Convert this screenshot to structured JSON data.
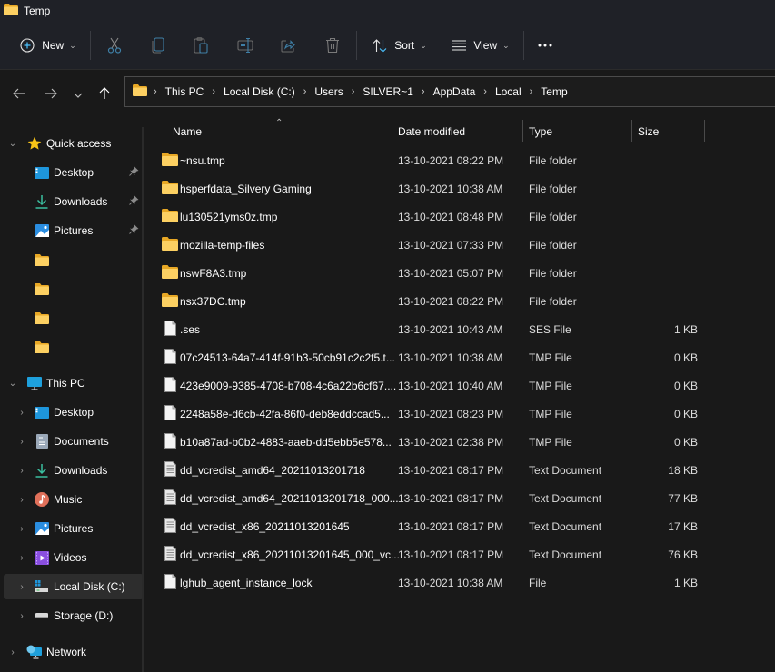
{
  "window": {
    "title": "Temp",
    "icon": "folder-icon"
  },
  "toolbar": {
    "new_label": "New",
    "sort_label": "Sort",
    "view_label": "View",
    "buttons": [
      {
        "name": "cut",
        "icon": "scissors-icon"
      },
      {
        "name": "copy",
        "icon": "copy-icon"
      },
      {
        "name": "paste",
        "icon": "paste-icon"
      },
      {
        "name": "rename",
        "icon": "rename-icon"
      },
      {
        "name": "share",
        "icon": "share-icon"
      },
      {
        "name": "delete",
        "icon": "trash-icon"
      }
    ],
    "more_icon": "ellipsis-icon"
  },
  "navigation": {
    "back_icon": "arrow-left-icon",
    "forward_icon": "arrow-right-icon",
    "recent_icon": "chevron-down-icon",
    "up_icon": "arrow-up-icon"
  },
  "breadcrumb": [
    "This PC",
    "Local Disk (C:)",
    "Users",
    "SILVER~1",
    "AppData",
    "Local",
    "Temp"
  ],
  "sidebar": {
    "quick_access": {
      "label": "Quick access",
      "items": [
        {
          "label": "Desktop",
          "icon": "desktop-icon",
          "pinned": true
        },
        {
          "label": "Downloads",
          "icon": "download-icon",
          "pinned": true
        },
        {
          "label": "Pictures",
          "icon": "pictures-icon",
          "pinned": true
        },
        {
          "label": "",
          "icon": "folder-icon",
          "pinned": false
        },
        {
          "label": "",
          "icon": "folder-icon",
          "pinned": false
        },
        {
          "label": "",
          "icon": "folder-icon",
          "pinned": false
        },
        {
          "label": "",
          "icon": "folder-icon",
          "pinned": false
        }
      ]
    },
    "this_pc": {
      "label": "This PC",
      "items": [
        {
          "label": "Desktop",
          "icon": "desktop-icon"
        },
        {
          "label": "Documents",
          "icon": "documents-icon"
        },
        {
          "label": "Downloads",
          "icon": "download-icon"
        },
        {
          "label": "Music",
          "icon": "music-icon"
        },
        {
          "label": "Pictures",
          "icon": "pictures-icon"
        },
        {
          "label": "Videos",
          "icon": "videos-icon"
        },
        {
          "label": "Local Disk (C:)",
          "icon": "system-drive-icon",
          "selected": true
        },
        {
          "label": "Storage (D:)",
          "icon": "drive-icon"
        }
      ]
    },
    "network": {
      "label": "Network",
      "icon": "network-icon"
    }
  },
  "columns": {
    "name": "Name",
    "date": "Date modified",
    "type": "Type",
    "size": "Size"
  },
  "files": [
    {
      "name": "~nsu.tmp",
      "date": "13-10-2021 08:22 PM",
      "type": "File folder",
      "size": "",
      "kind": "folder"
    },
    {
      "name": "hsperfdata_Silvery Gaming",
      "date": "13-10-2021 10:38 AM",
      "type": "File folder",
      "size": "",
      "kind": "folder"
    },
    {
      "name": "lu130521yms0z.tmp",
      "date": "13-10-2021 08:48 PM",
      "type": "File folder",
      "size": "",
      "kind": "folder"
    },
    {
      "name": "mozilla-temp-files",
      "date": "13-10-2021 07:33 PM",
      "type": "File folder",
      "size": "",
      "kind": "folder"
    },
    {
      "name": "nswF8A3.tmp",
      "date": "13-10-2021 05:07 PM",
      "type": "File folder",
      "size": "",
      "kind": "folder"
    },
    {
      "name": "nsx37DC.tmp",
      "date": "13-10-2021 08:22 PM",
      "type": "File folder",
      "size": "",
      "kind": "folder"
    },
    {
      "name": ".ses",
      "date": "13-10-2021 10:43 AM",
      "type": "SES File",
      "size": "1 KB",
      "kind": "file"
    },
    {
      "name": "07c24513-64a7-414f-91b3-50cb91c2c2f5.t...",
      "date": "13-10-2021 10:38 AM",
      "type": "TMP File",
      "size": "0 KB",
      "kind": "file"
    },
    {
      "name": "423e9009-9385-4708-b708-4c6a22b6cf67....",
      "date": "13-10-2021 10:40 AM",
      "type": "TMP File",
      "size": "0 KB",
      "kind": "file"
    },
    {
      "name": "2248a58e-d6cb-42fa-86f0-deb8eddccad5...",
      "date": "13-10-2021 08:23 PM",
      "type": "TMP File",
      "size": "0 KB",
      "kind": "file"
    },
    {
      "name": "b10a87ad-b0b2-4883-aaeb-dd5ebb5e578...",
      "date": "13-10-2021 02:38 PM",
      "type": "TMP File",
      "size": "0 KB",
      "kind": "file"
    },
    {
      "name": "dd_vcredist_amd64_20211013201718",
      "date": "13-10-2021 08:17 PM",
      "type": "Text Document",
      "size": "18 KB",
      "kind": "text"
    },
    {
      "name": "dd_vcredist_amd64_20211013201718_000...",
      "date": "13-10-2021 08:17 PM",
      "type": "Text Document",
      "size": "77 KB",
      "kind": "text"
    },
    {
      "name": "dd_vcredist_x86_20211013201645",
      "date": "13-10-2021 08:17 PM",
      "type": "Text Document",
      "size": "17 KB",
      "kind": "text"
    },
    {
      "name": "dd_vcredist_x86_20211013201645_000_vc...",
      "date": "13-10-2021 08:17 PM",
      "type": "Text Document",
      "size": "76 KB",
      "kind": "text"
    },
    {
      "name": "lghub_agent_instance_lock",
      "date": "13-10-2021 10:38 AM",
      "type": "File",
      "size": "1 KB",
      "kind": "file"
    }
  ],
  "colors": {
    "accent": "#4cc2ff",
    "folder": "#f4c542",
    "selected_bg": "#2d2d2d"
  }
}
